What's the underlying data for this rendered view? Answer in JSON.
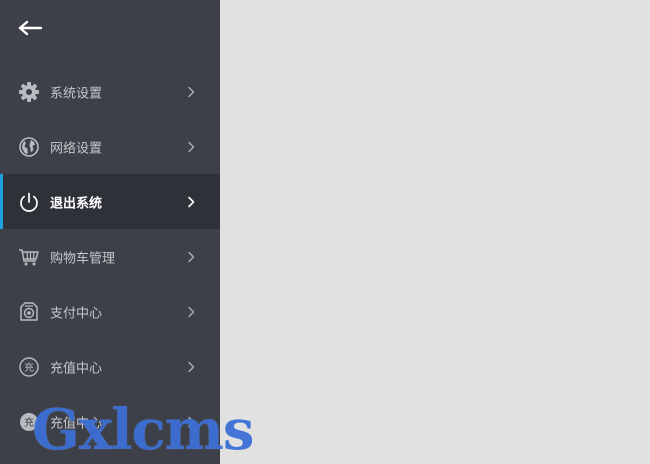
{
  "menu": [
    {
      "label": "系统设置",
      "icon": "gear-icon",
      "active": false
    },
    {
      "label": "网络设置",
      "icon": "globe-icon",
      "active": false
    },
    {
      "label": "退出系统",
      "icon": "power-icon",
      "active": true
    },
    {
      "label": "购物车管理",
      "icon": "cart-icon",
      "active": false
    },
    {
      "label": "支付中心",
      "icon": "payment-icon",
      "active": false
    },
    {
      "label": "充值中心",
      "icon": "recharge-icon",
      "active": false
    },
    {
      "label": "充值中心",
      "icon": "recharge-icon",
      "active": false
    }
  ],
  "watermark": "Gxlcms",
  "colors": {
    "sidebar_bg": "#3e4049",
    "active_bg": "#2f3138",
    "active_indicator": "#1ea0dc",
    "content_bg": "#e1e1e1",
    "watermark": "#3b6fd6"
  }
}
